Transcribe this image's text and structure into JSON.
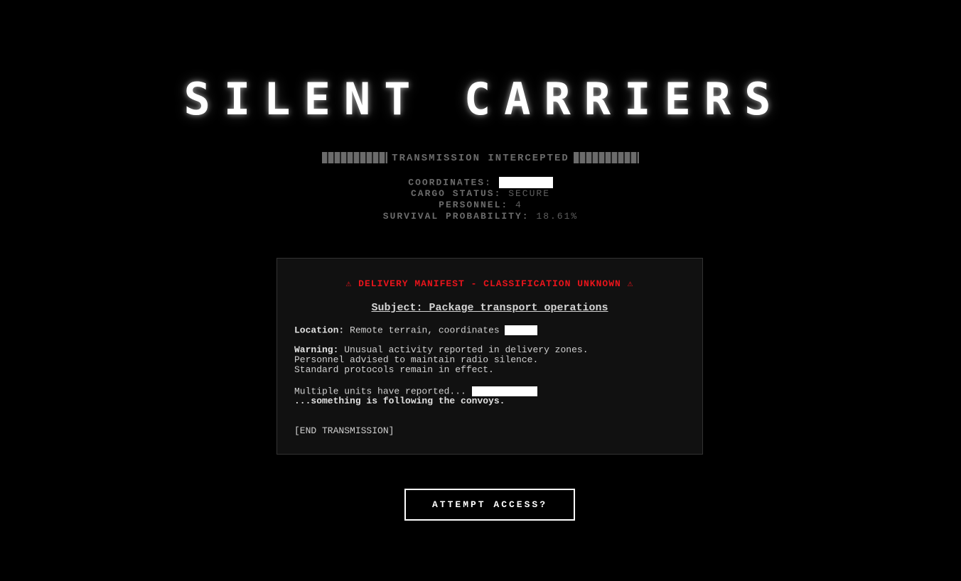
{
  "title": "SILENT CARRIERS",
  "intercept": {
    "text": "TRANSMISSION INTERCEPTED"
  },
  "stats": {
    "coordinates_label": "COORDINATES:",
    "cargo_label": "CARGO STATUS:",
    "cargo_value": "SECURE",
    "personnel_label": "PERSONNEL:",
    "personnel_value": "4",
    "survival_label": "SURVIVAL PROBABILITY:",
    "survival_value": "18.61%"
  },
  "manifest": {
    "heading": "⚠ DELIVERY MANIFEST - CLASSIFICATION UNKNOWN ⚠",
    "subject": "Subject: Package transport operations",
    "location_label": "Location:",
    "location_text": "Remote terrain, coordinates",
    "warning_label": "Warning:",
    "warning_line1": "Unusual activity reported in delivery zones.",
    "warning_line2": "Personnel advised to maintain radio silence.",
    "warning_line3": "Standard protocols remain in effect.",
    "report_line": "Multiple units have reported...",
    "following_line": "...something is following the convoys.",
    "end_line": "[END TRANSMISSION]"
  },
  "action": {
    "label": "ATTEMPT ACCESS?"
  },
  "colors": {
    "background": "#000000",
    "panel": "#111111",
    "alert_red": "#e8141b",
    "muted_gray": "#6b6b6b"
  }
}
